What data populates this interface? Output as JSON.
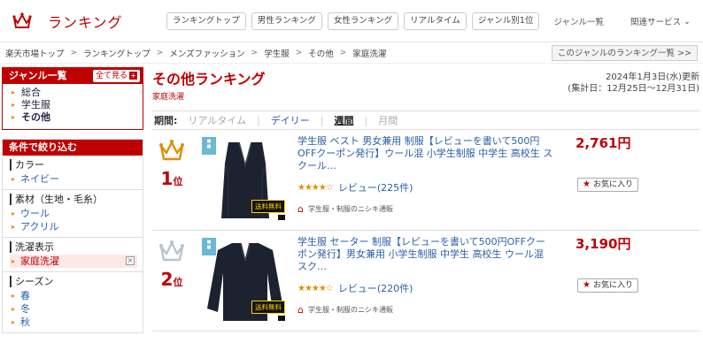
{
  "header": {
    "logo_text": "ランキング",
    "nav": [
      "ランキングトップ",
      "男性ランキング",
      "女性ランキング",
      "リアルタイム",
      "ジャンル別1位"
    ],
    "genre_list": "ジャンル一覧",
    "related_services": "関連サービス"
  },
  "breadcrumb": [
    "楽天市場トップ",
    "ランキングトップ",
    "メンズファッション",
    "学生服",
    "その他",
    "家庭洗濯"
  ],
  "genre_ranking_list_link": "このジャンルのランキング一覧 >>",
  "sidebar": {
    "genre_title": "ジャンル一覧",
    "see_all": "全て見る",
    "genres": [
      "総合",
      "学生服",
      "その他"
    ],
    "filter_title": "条件で絞り込む",
    "groups": [
      {
        "title": "カラー",
        "items": [
          "ネイビー"
        ]
      },
      {
        "title": "素材（生地・毛糸）",
        "items": [
          "ウール",
          "アクリル"
        ]
      },
      {
        "title": "洗濯表示",
        "items": [
          "家庭洗濯"
        ]
      },
      {
        "title": "シーズン",
        "items": [
          "春",
          "冬",
          "秋"
        ]
      }
    ]
  },
  "main": {
    "title": "その他ランキング",
    "subtitle": "家庭洗濯",
    "updated": "2024年1月3日(水)更新",
    "period_range": "(集計日：12月25日～12月31日)",
    "period_label": "期間:",
    "periods": {
      "realtime": "リアルタイム",
      "daily": "デイリー",
      "weekly": "週間",
      "monthly": "月間"
    }
  },
  "items": [
    {
      "rank": "1",
      "rank_suffix": "位",
      "title": "学生服 ベスト 男女兼用 制服【レビューを書いて500円OFFクーポン発行】ウール混 小学生制服 中学生 高校生 スクール…",
      "rating_text": "レビュー(225件)",
      "shop": "学生服・制服のニシキ通販",
      "price": "2,761円",
      "free_shipping": "送料無料",
      "fav": "お気に入り"
    },
    {
      "rank": "2",
      "rank_suffix": "位",
      "title": "学生服 セーター 制服【レビューを書いて500円OFFクーポン発行】男女兼用 小学生制服 中学生 高校生 ウール混 スク…",
      "rating_text": "レビュー(220件)",
      "shop": "学生服・制服のニシキ通販",
      "price": "3,190円",
      "free_shipping": "送料無料",
      "fav": "お気に入り"
    }
  ],
  "colors": {
    "brand": "#bf0000",
    "link": "#2a5fa8",
    "gold": "#e09000",
    "silver": "#b8c4cc"
  }
}
